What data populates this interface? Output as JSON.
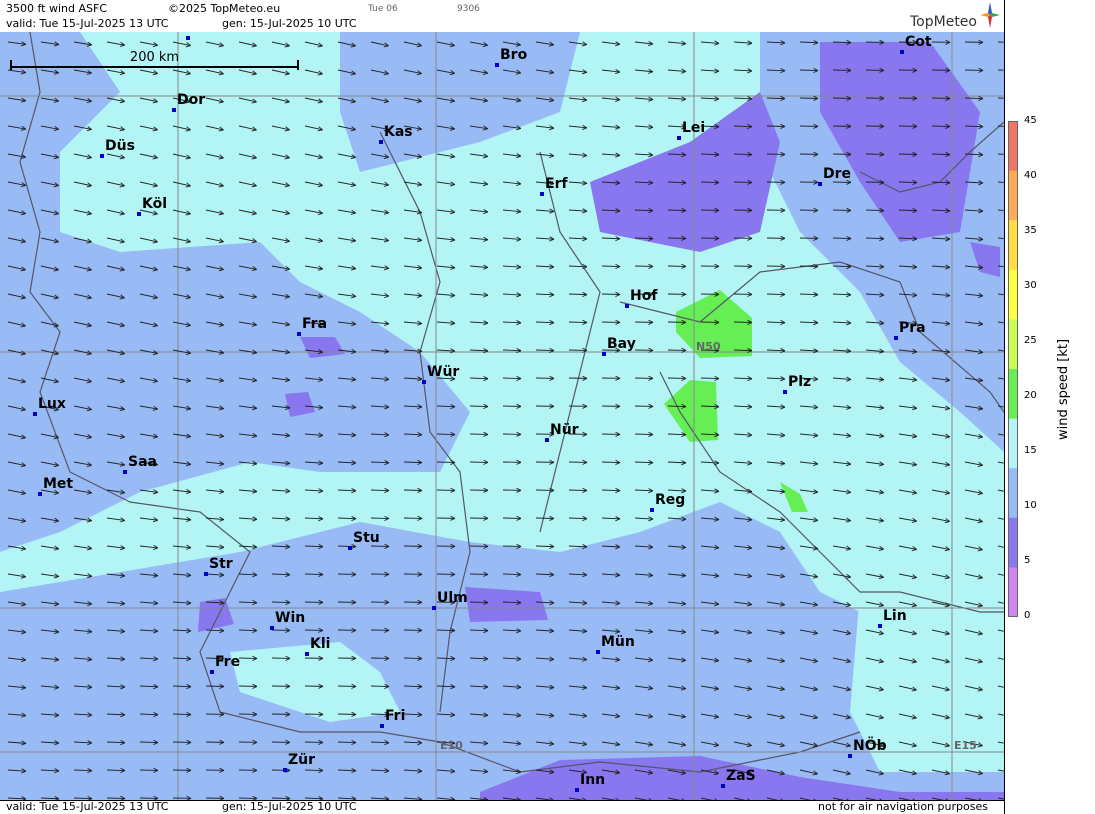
{
  "header": {
    "title": "3500 ft wind ASFC",
    "copyright": "©2025 TopMeteo.eu",
    "valid": "valid:  Tue  15-Jul-2025  13 UTC",
    "gen": "gen: 15-Jul-2025 10 UTC",
    "run": "Tue 06",
    "code": "9306"
  },
  "logo": {
    "text": "TopMeteo",
    "icon": "compass-star-icon"
  },
  "footer": {
    "valid": "valid:  Tue  15-Jul-2025  13 UTC",
    "gen": "gen: 15-Jul-2025 10 UTC",
    "disclaimer": "not for air navigation purposes"
  },
  "scale": {
    "label": "200 km"
  },
  "grid_labels": {
    "lat": "N50",
    "lon1": "E10",
    "lon2": "E15"
  },
  "legend": {
    "title": "wind speed [kt]",
    "ticks": [
      "45",
      "40",
      "35",
      "30",
      "25",
      "20",
      "15",
      "10",
      "5",
      "0"
    ],
    "colors": [
      "#ee7766",
      "#ffaa55",
      "#ffdd44",
      "#ffff44",
      "#ccff55",
      "#66ee55",
      "#b3f5f5",
      "#99bbf5",
      "#8877ee",
      "#cc88ee"
    ]
  },
  "cities": {
    "mun_top": "Mün",
    "bro": "Bro",
    "cot": "Cot",
    "dor": "Dor",
    "kas": "Kas",
    "lei": "Lei",
    "dus": "Düs",
    "erf": "Erf",
    "dre": "Dre",
    "kol": "Köl",
    "hof": "Hof",
    "fra": "Fra",
    "pra": "Pra",
    "bay": "Bay",
    "wur": "Wür",
    "plz": "Plz",
    "lux": "Lux",
    "nur": "Nür",
    "saa": "Saa",
    "met": "Met",
    "reg": "Reg",
    "stu": "Stu",
    "str": "Str",
    "ulm": "Ulm",
    "win": "Win",
    "lin": "Lin",
    "kli": "Kli",
    "mun": "Mün",
    "fre": "Fre",
    "fri": "Fri",
    "nob": "NÖb",
    "zur": "Zür",
    "inn": "Inn",
    "zas": "ZaS"
  }
}
